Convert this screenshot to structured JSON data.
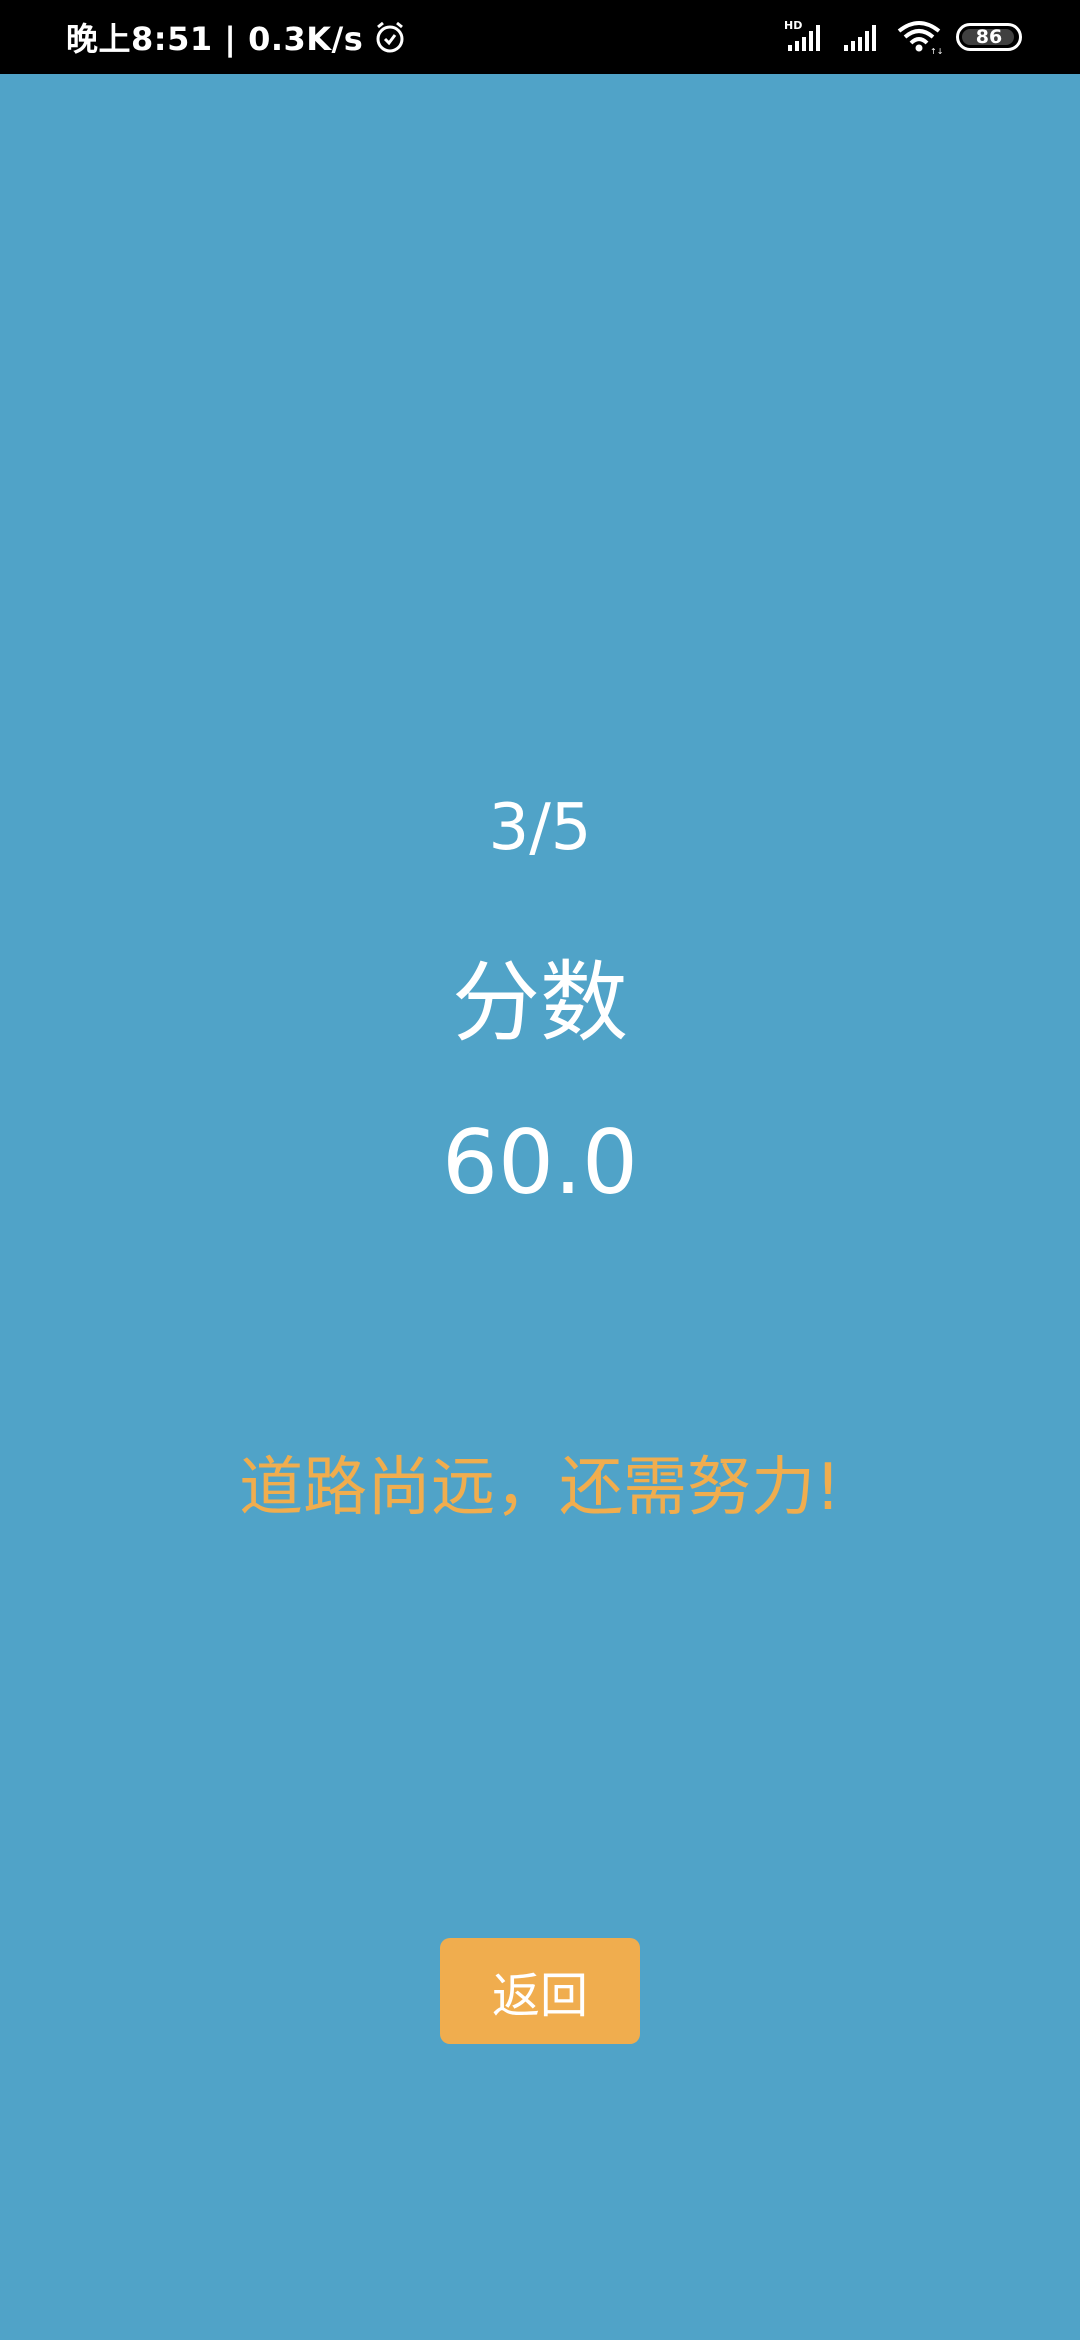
{
  "status_bar": {
    "left_text": "晚上8:51 | 0.3K/s",
    "battery_level": "86",
    "network_badge": "HD",
    "icons": [
      "alarm-icon",
      "hd-signal-icon",
      "signal-icon",
      "wifi-icon",
      "battery-icon"
    ]
  },
  "result": {
    "progress": "3/5",
    "score_label": "分数",
    "score_value": "60.0",
    "message": "道路尚远，还需努力!"
  },
  "actions": {
    "back_label": "返回"
  },
  "colors": {
    "background": "#50a3c8",
    "accent": "#f0ad4e",
    "text": "#ffffff",
    "status_bar": "#000000"
  }
}
